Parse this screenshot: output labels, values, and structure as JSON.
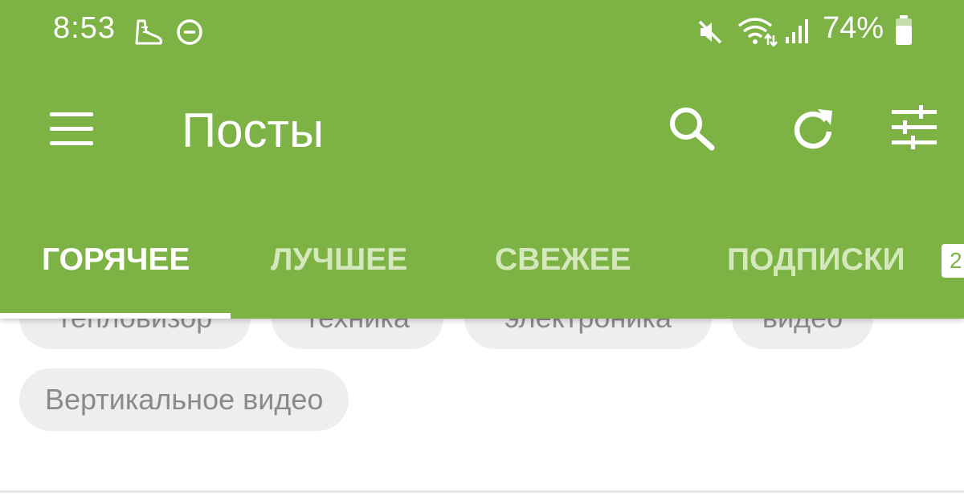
{
  "status_bar": {
    "time": "8:53",
    "battery": "74%",
    "icons": [
      "step-counter-icon",
      "dnd-icon",
      "mute-icon",
      "wifi-icon",
      "signal-icon",
      "battery-icon"
    ]
  },
  "toolbar": {
    "title": "Посты",
    "icons": [
      "menu-icon",
      "search-icon",
      "refresh-icon",
      "filter-icon"
    ]
  },
  "tabs": [
    {
      "label": "ГОРЯЧЕЕ",
      "active": true
    },
    {
      "label": "ЛУЧШЕЕ",
      "active": false
    },
    {
      "label": "СВЕЖЕЕ",
      "active": false
    },
    {
      "label": "ПОДПИСКИ",
      "active": false,
      "badge": "2"
    }
  ],
  "tags": [
    "тепловизор",
    "техника",
    "электроника",
    "видео",
    "Вертикальное видео"
  ],
  "colors": {
    "app_bar": "#7db244",
    "tab_inactive": "#d5e8bd",
    "chip_bg": "#eeeeee",
    "chip_text": "#8a8a8a"
  }
}
